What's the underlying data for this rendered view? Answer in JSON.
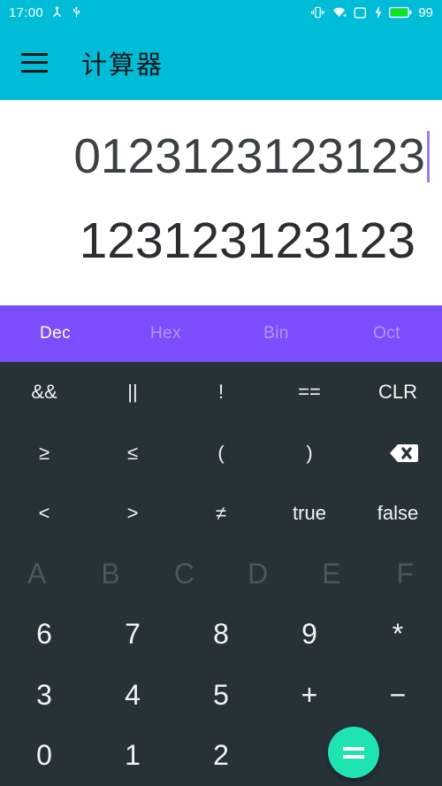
{
  "status_bar": {
    "time": "17:00",
    "left_icons": [
      "debug-person-icon",
      "usb-icon"
    ],
    "right_icons": [
      "vibrate-icon",
      "wifi-icon",
      "sim-card-icon",
      "charging-bolt-icon",
      "battery-icon"
    ],
    "battery_level": "99",
    "background_color": "#00bcd6",
    "text_color": "#ffffff"
  },
  "app_bar": {
    "menu_icon": "hamburger-menu-icon",
    "title": "计算器",
    "background_color": "#00bcd6",
    "title_color": "#10161a"
  },
  "display": {
    "input": "0123123123123",
    "result": "123123123123",
    "cursor_color": "#9a7bf4",
    "background_color": "#ffffff"
  },
  "tabs": {
    "background_color": "#7c4dfd",
    "active_color": "#ffffff",
    "inactive_color": "rgba(255,255,255,0.42)",
    "items": [
      {
        "label": "Dec",
        "active": true
      },
      {
        "label": "Hex",
        "active": false
      },
      {
        "label": "Bin",
        "active": false
      },
      {
        "label": "Oct",
        "active": false
      }
    ]
  },
  "keypad": {
    "background_color": "#263238",
    "rows": [
      {
        "name": "logic-row",
        "keys": [
          {
            "label": "&&",
            "name": "key-and"
          },
          {
            "label": "||",
            "name": "key-or"
          },
          {
            "label": "!",
            "name": "key-not"
          },
          {
            "label": "==",
            "name": "key-equals-equals"
          },
          {
            "label": "CLR",
            "name": "key-clear"
          }
        ]
      },
      {
        "name": "compare-paren-row",
        "keys": [
          {
            "label": "≥",
            "name": "key-greater-equal"
          },
          {
            "label": "≤",
            "name": "key-less-equal"
          },
          {
            "label": "(",
            "name": "key-open-paren"
          },
          {
            "label": ")",
            "name": "key-close-paren"
          },
          {
            "label": "",
            "name": "key-backspace",
            "icon": "backspace-icon"
          }
        ]
      },
      {
        "name": "compare-bool-row",
        "keys": [
          {
            "label": "<",
            "name": "key-less-than"
          },
          {
            "label": ">",
            "name": "key-greater-than"
          },
          {
            "label": "≠",
            "name": "key-not-equal"
          },
          {
            "label": "true",
            "name": "key-true"
          },
          {
            "label": "false",
            "name": "key-false"
          }
        ]
      },
      {
        "name": "hex-letters-row",
        "disabled": true,
        "keys": [
          {
            "label": "A",
            "name": "key-a"
          },
          {
            "label": "B",
            "name": "key-b"
          },
          {
            "label": "C",
            "name": "key-c"
          },
          {
            "label": "D",
            "name": "key-d"
          },
          {
            "label": "E",
            "name": "key-e"
          },
          {
            "label": "F",
            "name": "key-f"
          }
        ]
      },
      {
        "name": "digits-6789-row",
        "keys": [
          {
            "label": "6",
            "name": "key-6"
          },
          {
            "label": "7",
            "name": "key-7"
          },
          {
            "label": "8",
            "name": "key-8"
          },
          {
            "label": "9",
            "name": "key-9"
          },
          {
            "label": "*",
            "name": "key-multiply"
          }
        ]
      },
      {
        "name": "digits-345-row",
        "keys": [
          {
            "label": "3",
            "name": "key-3"
          },
          {
            "label": "4",
            "name": "key-4"
          },
          {
            "label": "5",
            "name": "key-5"
          },
          {
            "label": "+",
            "name": "key-plus"
          },
          {
            "label": "−",
            "name": "key-minus"
          }
        ]
      },
      {
        "name": "digits-012-row",
        "keys": [
          {
            "label": "0",
            "name": "key-0"
          },
          {
            "label": "1",
            "name": "key-1"
          },
          {
            "label": "2",
            "name": "key-2"
          },
          {
            "label": "",
            "name": "key-spacer-1"
          },
          {
            "label": "",
            "name": "key-spacer-2"
          }
        ]
      }
    ],
    "equals_button": {
      "label": "=",
      "name": "equals-fab",
      "color": "#20e3b2"
    }
  }
}
